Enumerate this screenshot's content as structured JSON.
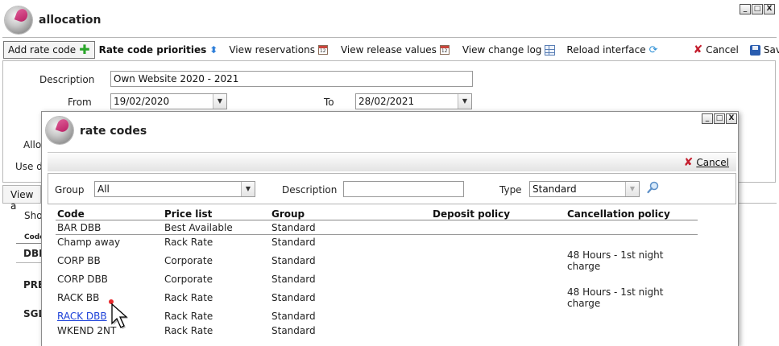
{
  "outer_window": {
    "title": "allocation",
    "window_buttons": [
      "_",
      "□",
      "X"
    ]
  },
  "toolbar": {
    "add_rate_code": "Add rate code",
    "rate_code_priorities": "Rate code priorities",
    "view_reservations": "View reservations",
    "view_release_values": "View release values",
    "view_change_log": "View change log",
    "reload_interface": "Reload interface",
    "cancel": "Cancel",
    "save": "Save"
  },
  "form": {
    "description_label": "Description",
    "description_value": "Own Website 2020 - 2021",
    "from_label": "From",
    "from_value": "19/02/2020",
    "to_label": "To",
    "to_value": "28/02/2021",
    "partial_labels": [
      "Allo",
      "Use d"
    ]
  },
  "background": {
    "tab_partial": "View a",
    "show_partial": "Sho",
    "code_header_partial": "Code",
    "row_partials": [
      "DBL",
      "PRE",
      "SGL"
    ]
  },
  "dialog": {
    "title": "rate codes",
    "cancel": "Cancel",
    "filters": {
      "group_label": "Group",
      "group_value": "All",
      "description_label": "Description",
      "description_value": "",
      "type_label": "Type",
      "type_value": "Standard"
    },
    "table": {
      "columns": [
        "Code",
        "Price list",
        "Group",
        "Deposit policy",
        "Cancellation policy"
      ],
      "rows": [
        [
          "BAR DBB",
          "Best Available",
          "Standard",
          "",
          ""
        ],
        [
          "Champ away",
          "Rack Rate",
          "Standard",
          "",
          ""
        ],
        [
          "CORP BB",
          "Corporate",
          "Standard",
          "",
          "48 Hours - 1st night charge"
        ],
        [
          "CORP DBB",
          "Corporate",
          "Standard",
          "",
          ""
        ],
        [
          "RACK BB",
          "Rack Rate",
          "Standard",
          "",
          "48 Hours - 1st night charge"
        ],
        [
          "RACK DBB",
          "Rack Rate",
          "Standard",
          "",
          ""
        ],
        [
          "WKEND 2NT",
          "Rack Rate",
          "Standard",
          "",
          ""
        ]
      ]
    }
  },
  "colors": {
    "link": "#1a3fd8",
    "cancel_icon": "#c41e2e",
    "add_icon": "#2aa52a",
    "brand_pink": "#c8236e"
  },
  "icons": [
    "app-logo-icon",
    "plus-icon",
    "sort-arrows-icon",
    "calendar-icon",
    "grid-icon",
    "refresh-icon",
    "cancel-x-icon",
    "save-disk-icon",
    "search-magnifier-icon",
    "mouse-cursor-icon"
  ]
}
